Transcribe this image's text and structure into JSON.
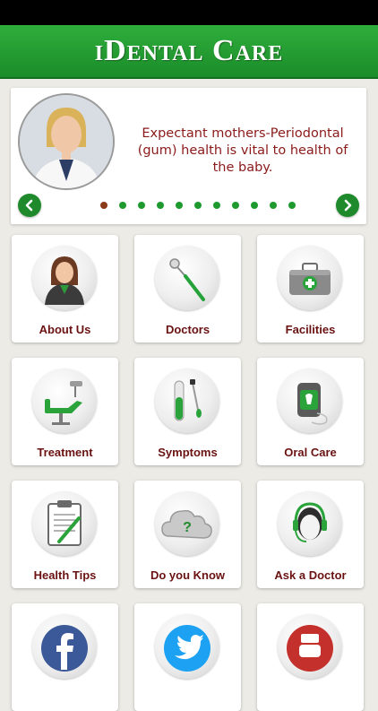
{
  "app": {
    "title": "iDental Care"
  },
  "banner": {
    "message": "Expectant mothers-Periodontal (gum) health is vital to health of the baby.",
    "pages": 11,
    "active_page": 1
  },
  "tiles": [
    {
      "label": "About Us",
      "icon": "person-icon"
    },
    {
      "label": "Doctors",
      "icon": "dental-mirror-icon"
    },
    {
      "label": "Facilities",
      "icon": "medical-kit-icon"
    },
    {
      "label": "Treatment",
      "icon": "dental-chair-icon"
    },
    {
      "label": "Symptoms",
      "icon": "test-tube-icon"
    },
    {
      "label": "Oral Care",
      "icon": "floss-icon"
    },
    {
      "label": "Health Tips",
      "icon": "clipboard-icon"
    },
    {
      "label": "Do you Know",
      "icon": "question-cloud-icon"
    },
    {
      "label": "Ask a Doctor",
      "icon": "headset-icon"
    },
    {
      "label": "",
      "icon": "facebook-icon"
    },
    {
      "label": "",
      "icon": "twitter-icon"
    },
    {
      "label": "",
      "icon": "youtube-icon"
    }
  ],
  "colors": {
    "brand_green": "#1f8a2c",
    "label_red": "#6a1212",
    "banner_text": "#8b1a1a"
  }
}
